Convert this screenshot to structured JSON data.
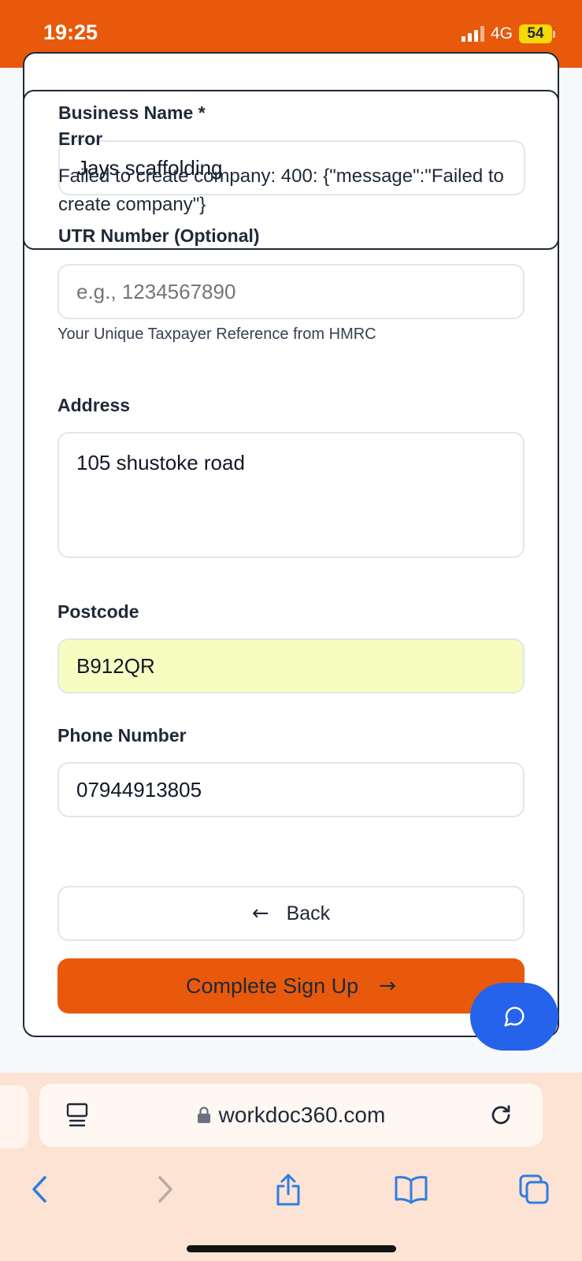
{
  "status_bar": {
    "time": "19:25",
    "network": "4G",
    "battery": "54"
  },
  "form": {
    "business_name": {
      "label": "Business Name *",
      "value": "Jays scaffolding"
    },
    "utr": {
      "label": "UTR Number (Optional)",
      "placeholder": "e.g., 1234567890",
      "hint": "Your Unique Taxpayer Reference from HMRC"
    },
    "address": {
      "label": "Address",
      "value": "105 shustoke road"
    },
    "postcode": {
      "label": "Postcode",
      "value": "B912QR"
    },
    "phone": {
      "label": "Phone Number",
      "value": "07944913805"
    },
    "back_label": "Back",
    "submit_label": "Complete Sign Up"
  },
  "toast": {
    "title": "Error",
    "message": "Failed to create company: 400: {\"message\":\"Failed to create company\"}"
  },
  "browser": {
    "url": "workdoc360.com"
  },
  "colors": {
    "brand": "#e8590c",
    "fab": "#2563eb",
    "autofill": "#f7fdc0"
  },
  "icons": [
    "chevron-left-icon",
    "chevron-right-icon",
    "share-icon",
    "bookmarks-icon",
    "tabs-icon",
    "reader-icon",
    "lock-icon",
    "reload-icon",
    "chat-icon",
    "arrow-left-icon",
    "arrow-right-icon"
  ]
}
